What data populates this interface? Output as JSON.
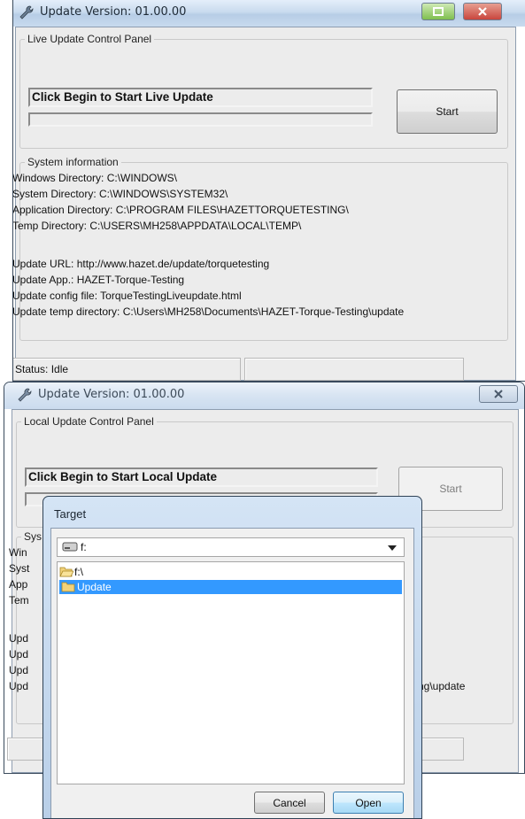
{
  "window1": {
    "title": "Update Version: 01.00.00",
    "panel_title": "Live Update Control Panel",
    "message": "Click Begin to Start Live Update",
    "start_label": "Start",
    "sysinfo_title": "System information",
    "lines": [
      "Windows Directory: C:\\WINDOWS\\",
      "System Directory: C:\\WINDOWS\\SYSTEM32\\",
      "Application Directory: C:\\PROGRAM FILES\\HAZETTORQUETESTING\\",
      "Temp Directory: C:\\USERS\\MH258\\APPDATA\\LOCAL\\TEMP\\",
      "Update URL: http://www.hazet.de/update/torquetesting",
      "Update App.: HAZET-Torque-Testing",
      "Update config file: TorqueTestingLiveupdate.html",
      "Update temp directory: C:\\Users\\MH258\\Documents\\HAZET-Torque-Testing\\update"
    ],
    "status": "Status: Idle"
  },
  "window2": {
    "title": "Update Version: 01.00.00",
    "panel_title": "Local Update Control Panel",
    "message": "Click Begin to Start Local Update",
    "start_label": "Start",
    "sysinfo_title_partial": "Sys",
    "line_partials": [
      "Win",
      "Syst",
      "App",
      "Tem",
      "Upd",
      "Upd",
      "Upd",
      "Upd"
    ],
    "last_line_tail": "ng\\update"
  },
  "dialog": {
    "title": "Target",
    "drive_value": "f:",
    "tree": [
      {
        "label": "f:\\",
        "selected": false
      },
      {
        "label": "Update",
        "selected": true
      }
    ],
    "cancel_label": "Cancel",
    "open_label": "Open"
  },
  "colors": {
    "selection": "#3399ff",
    "title_gradient": "#c9dbee",
    "close_red": "#c9463d"
  }
}
